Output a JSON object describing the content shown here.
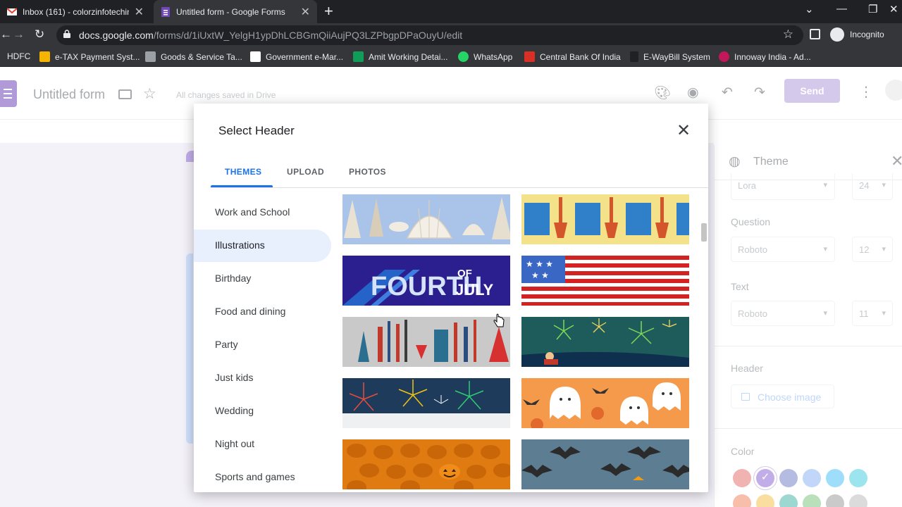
{
  "browser": {
    "tabs": [
      {
        "title": "Inbox (161) - colorzinfotechindia",
        "close": "✕"
      },
      {
        "title": "Untitled form - Google Forms",
        "close": "✕"
      }
    ],
    "new_tab": "+",
    "window_controls": [
      "⌄",
      "—",
      "❐",
      "✕"
    ],
    "url_host": "docs.google.com",
    "url_path": "/forms/d/1iUxtW_YelgH1ypDhLCBGmQiiAujPQ3LZPbgpDPaOuyU/edit",
    "profile_label": "Incognito",
    "bookmarks": [
      "HDFC",
      "e-TAX Payment Syst...",
      "Goods & Service Ta...",
      "Government e-Mar...",
      "Amit Working Detai...",
      "WhatsApp",
      "Central Bank Of India",
      "E-WayBill System",
      "Innoway India - Ad..."
    ]
  },
  "app": {
    "form_title": "Untitled form",
    "save_status": "All changes saved in Drive",
    "send_label": "Send"
  },
  "theme_panel": {
    "title": "Theme",
    "header_font": "Lora",
    "header_size": "24",
    "question_label": "Question",
    "question_font": "Roboto",
    "question_size": "12",
    "text_label": "Text",
    "text_font": "Roboto",
    "text_size": "11",
    "header_label": "Header",
    "choose_image": "Choose image",
    "color_label": "Color",
    "colors": [
      "#e57373",
      "#8e6bd6",
      "#7986cb",
      "#90b4f4",
      "#4fc3f7",
      "#4dd0e1"
    ],
    "colors_row2": [
      "#f08a65",
      "#f6c453",
      "#4db6ac",
      "#81c784",
      "#9e9e9e",
      "#bdbdbd"
    ]
  },
  "dialog": {
    "title": "Select Header",
    "tabs": [
      "THEMES",
      "UPLOAD",
      "PHOTOS"
    ],
    "active_tab": "THEMES",
    "categories": [
      "Work and School",
      "Illustrations",
      "Birthday",
      "Food and dining",
      "Party",
      "Just kids",
      "Wedding",
      "Night out",
      "Sports and games"
    ],
    "active_category": "Illustrations",
    "tiles": [
      "seashells",
      "sand-buckets",
      "fourth-of-july",
      "american-flag",
      "firecrackers",
      "fireworks-beach",
      "fireworks-night",
      "ghosts",
      "pumpkins",
      "bats"
    ],
    "tile_text": {
      "fourth": "FOURTH",
      "of": "OF",
      "july": "JULY"
    }
  }
}
